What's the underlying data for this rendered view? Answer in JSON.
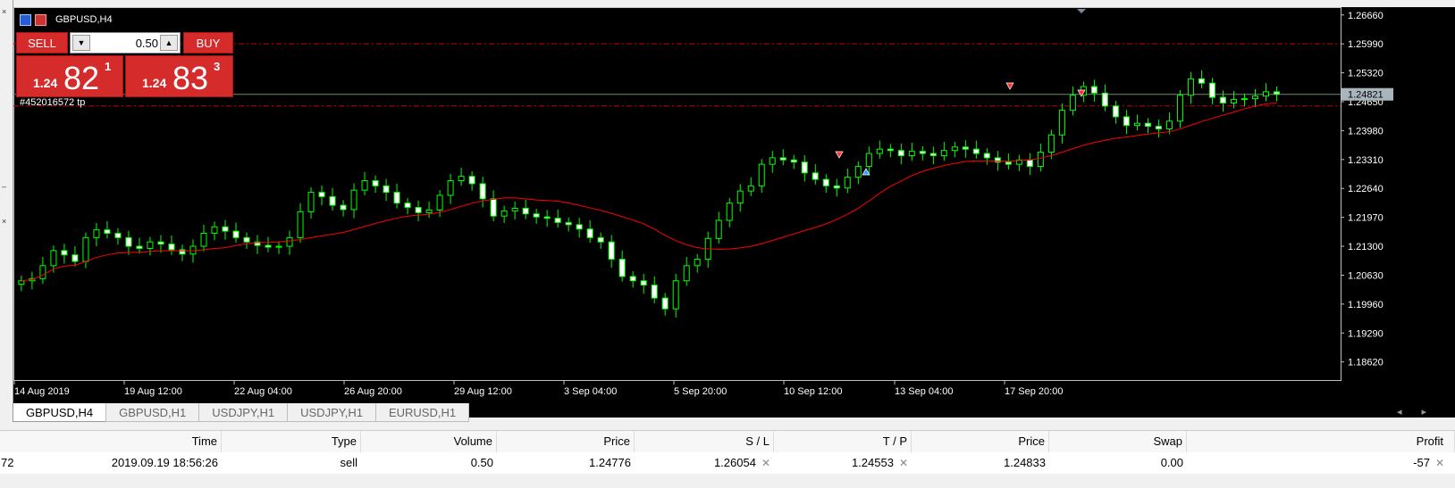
{
  "chart": {
    "title": "GBPUSD,H4",
    "trade_label": "#452016572 tp",
    "current_price": "1.24821",
    "price_labels": [
      "1.26660",
      "1.25990",
      "1.25320",
      "1.24650",
      "1.23980",
      "1.23310",
      "1.22640",
      "1.21970",
      "1.21300",
      "1.20630",
      "1.19960",
      "1.19290",
      "1.18620"
    ],
    "date_labels": [
      "14 Aug 2019",
      "19 Aug 12:00",
      "22 Aug 04:00",
      "26 Aug 20:00",
      "29 Aug 12:00",
      "3 Sep 04:00",
      "5 Sep 20:00",
      "10 Sep 12:00",
      "13 Sep 04:00",
      "17 Sep 20:00"
    ],
    "colors": {
      "background": "#000000",
      "candle": "#00ff00",
      "moving_average": "#ff0000",
      "level_lines": "#cc0000",
      "price_line": "#6e8c6e"
    }
  },
  "trade_panel": {
    "sell_label": "SELL",
    "buy_label": "BUY",
    "volume": "0.50",
    "sell_price": {
      "prefix": "1.24",
      "big": "82",
      "sup": "1"
    },
    "buy_price": {
      "prefix": "1.24",
      "big": "83",
      "sup": "3"
    }
  },
  "tabs": [
    "GBPUSD,H4",
    "GBPUSD,H1",
    "USDJPY,H1",
    "USDJPY,H1",
    "EURUSD,H1"
  ],
  "active_tab": 0,
  "trade_table": {
    "headers": [
      "Time",
      "Type",
      "Volume",
      "Price",
      "S / L",
      "T / P",
      "Price",
      "Swap",
      "Profit"
    ],
    "row": {
      "ticket_fragment": "72",
      "cells": [
        "2019.09.19 18:56:26",
        "sell",
        "0.50",
        "1.24776",
        "1.26054",
        "1.24553",
        "1.24833",
        "0.00",
        "-57"
      ]
    }
  },
  "chart_data": {
    "type": "candlestick",
    "symbol": "GBPUSD",
    "timeframe": "H4",
    "ylim": [
      1.182,
      1.268
    ],
    "yticks": [
      1.2666,
      1.2599,
      1.2532,
      1.2465,
      1.2398,
      1.2331,
      1.2264,
      1.2197,
      1.213,
      1.2063,
      1.1996,
      1.1929,
      1.1862
    ],
    "levels": {
      "sl": 1.2599,
      "tp": 1.24553,
      "bid": 1.24821
    },
    "close": [
      1.205,
      1.2055,
      1.2085,
      1.212,
      1.211,
      1.2095,
      1.215,
      1.2168,
      1.216,
      1.215,
      1.213,
      1.2125,
      1.214,
      1.2135,
      1.2122,
      1.2112,
      1.213,
      1.216,
      1.2175,
      1.2165,
      1.215,
      1.214,
      1.2132,
      1.2128,
      1.213,
      1.215,
      1.221,
      1.2255,
      1.2245,
      1.2225,
      1.2215,
      1.226,
      1.2282,
      1.227,
      1.2255,
      1.223,
      1.222,
      1.2208,
      1.2214,
      1.2248,
      1.2282,
      1.2292,
      1.2275,
      1.224,
      1.22,
      1.2212,
      1.2218,
      1.2205,
      1.2198,
      1.2195,
      1.2185,
      1.218,
      1.217,
      1.215,
      1.214,
      1.21,
      1.206,
      1.205,
      1.204,
      1.201,
      1.1985,
      1.205,
      1.2085,
      1.21,
      1.2148,
      1.219,
      1.223,
      1.2258,
      1.227,
      1.232,
      1.2335,
      1.233,
      1.2325,
      1.23,
      1.2285,
      1.227,
      1.2265,
      1.229,
      1.2315,
      1.2345,
      1.2355,
      1.2352,
      1.234,
      1.235,
      1.2345,
      1.234,
      1.2352,
      1.236,
      1.2355,
      1.2345,
      1.2335,
      1.2325,
      1.232,
      1.233,
      1.2315,
      1.2348,
      1.2388,
      1.2445,
      1.248,
      1.25,
      1.2485,
      1.2455,
      1.243,
      1.241,
      1.2415,
      1.2408,
      1.2402,
      1.242,
      1.248,
      1.2518,
      1.2508,
      1.2475,
      1.2462,
      1.247,
      1.2472,
      1.2478,
      1.2488,
      1.2482
    ]
  }
}
